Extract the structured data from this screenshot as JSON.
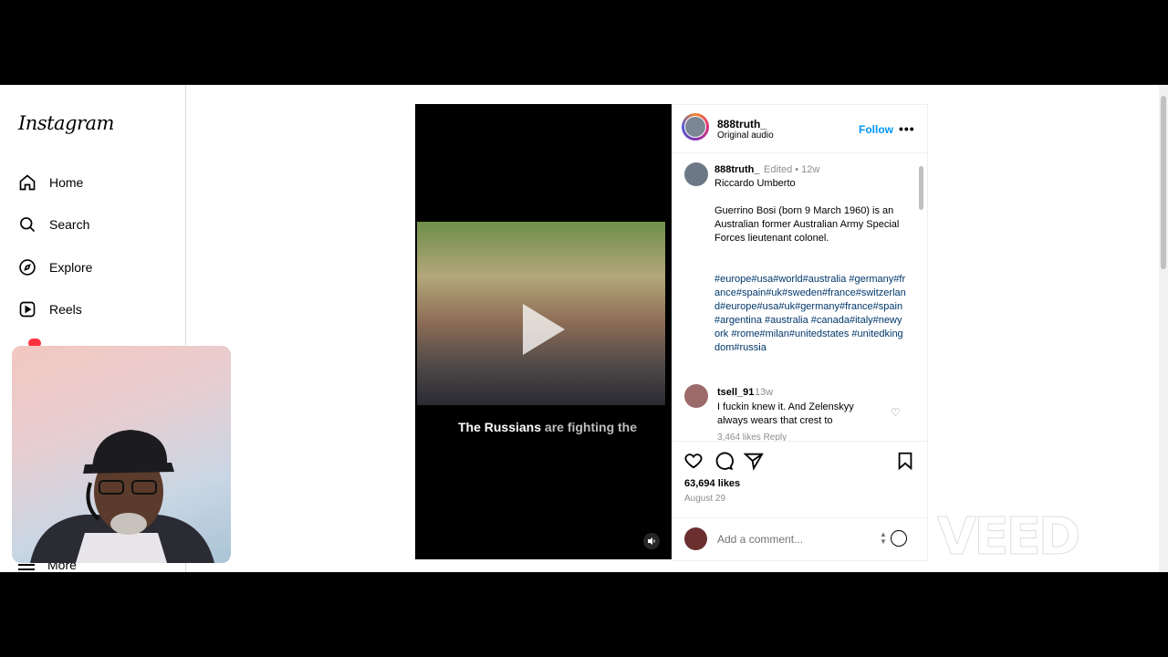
{
  "sidebar": {
    "logo": "Instagram",
    "items": [
      {
        "label": "Home"
      },
      {
        "label": "Search"
      },
      {
        "label": "Explore"
      },
      {
        "label": "Reels"
      }
    ],
    "more_label": "More"
  },
  "video": {
    "caption_bold": "The Russians",
    "caption_rest": " are fighting the"
  },
  "post": {
    "username": "888truth_",
    "audio": "Original audio",
    "follow": "Follow",
    "more": "•••",
    "caption": {
      "username": "888truth_",
      "meta": "Edited • 12w",
      "name": "Riccardo Umberto",
      "text": "Guerrino Bosi (born 9 March 1960) is an Australian former Australian Army Special Forces lieutenant colonel.",
      "hashtags": "#europe#usa#world#australia #germany#france#spain#uk#sweden#france#switzerland#europe#usa#uk#germany#france#spain#argentina #australia #canada#italy#newyork #rome#milan#unitedstates #unitedkingdom#russia"
    },
    "comment": {
      "username": "tsell_91",
      "time": "13w",
      "text": "I fuckin knew it. And Zelenskyy always wears that crest to",
      "likes": "3,464 likes   Reply"
    },
    "likes": "63,694 likes",
    "date": "August 29",
    "add_comment_placeholder": "Add a comment..."
  },
  "watermark": "VEED",
  "colors": {
    "accent": "#0095f6",
    "hashtag": "#00376b",
    "badge": "#ff3040"
  }
}
